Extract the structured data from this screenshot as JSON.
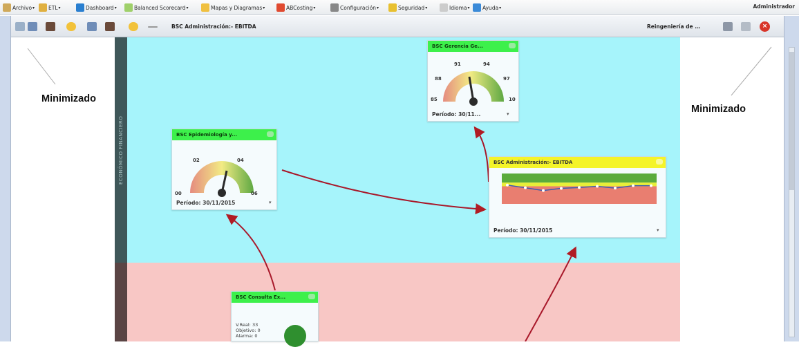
{
  "menubar": {
    "items": [
      {
        "label": "Archivo",
        "color": "#cfa95a"
      },
      {
        "label": "ETL",
        "color": "#e0b040"
      },
      {
        "label": "Dashboard",
        "color": "#2a7fd0"
      },
      {
        "label": "Balanced Scorecard",
        "color": "#9fd06a"
      },
      {
        "label": "Mapas y Diagramas",
        "color": "#f0c040"
      },
      {
        "label": "ABCosting",
        "color": "#e04a30"
      },
      {
        "label": "Configuración",
        "color": "#888888"
      },
      {
        "label": "Seguridad",
        "color": "#e8c030"
      },
      {
        "label": "Idioma",
        "color": "#cccccc"
      },
      {
        "label": "Ayuda",
        "color": "#3a8ad8"
      }
    ],
    "user": "Administrador"
  },
  "toolbar": {
    "title": "BSC Administración:- EBITDA",
    "right_label": "Reingeniería de ..."
  },
  "strip_label": "ECONÓMICO FINANCIERO",
  "annotations": {
    "left": "Minimizado",
    "right": "Minimizado"
  },
  "cards": {
    "gerencia": {
      "title": "BSC Gerencia Ge...",
      "ticks": [
        "85",
        "88",
        "91",
        "94",
        "97",
        "10"
      ],
      "period": "Período: 30/11...",
      "value_fraction": 0.5
    },
    "epidemiologia": {
      "title": "BSC Epidemiología y...",
      "ticks": [
        "00",
        "02",
        "04",
        "06"
      ],
      "period": "Período: 30/11/2015",
      "value_fraction": 0.55
    },
    "ebitda": {
      "title": "BSC Administración:- EBITDA",
      "period": "Período: 30/11/2015",
      "header_color": "#f4f429"
    },
    "consulta": {
      "title": "BSC Consulta Ex...",
      "lines": [
        "V.Real:  33",
        "Objetivo: 0",
        "Alarma:  0"
      ]
    }
  },
  "chart_data": {
    "type": "line",
    "values": [
      0.62,
      0.53,
      0.44,
      0.51,
      0.54,
      0.58,
      0.52,
      0.6,
      0.6
    ],
    "bands": {
      "top": "#5bab3c",
      "middle": "#e8ee39",
      "bottom": "#e97e70"
    }
  }
}
